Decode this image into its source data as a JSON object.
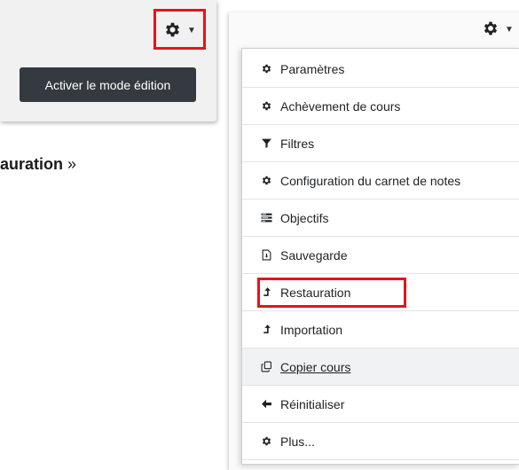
{
  "left": {
    "edit_button_label": "Activer le mode édition"
  },
  "doc": {
    "text_bold": "auration",
    "text_tail": " »"
  },
  "menu": {
    "items": [
      {
        "label": "Paramètres",
        "icon": "gear-icon"
      },
      {
        "label": "Achèvement de cours",
        "icon": "gear-icon"
      },
      {
        "label": "Filtres",
        "icon": "filter-icon"
      },
      {
        "label": "Configuration du carnet de notes",
        "icon": "gear-icon"
      },
      {
        "label": "Objectifs",
        "icon": "list-icon"
      },
      {
        "label": "Sauvegarde",
        "icon": "backup-file-icon"
      },
      {
        "label": "Restauration",
        "icon": "upload-arrow-icon"
      },
      {
        "label": "Importation",
        "icon": "upload-arrow-icon"
      },
      {
        "label": "Copier cours",
        "icon": "copy-icon"
      },
      {
        "label": "Réinitialiser",
        "icon": "arrow-left-icon"
      },
      {
        "label": "Plus...",
        "icon": "gear-icon"
      }
    ]
  },
  "colors": {
    "highlight_red": "#e3141c",
    "button_dark": "#343a40"
  }
}
